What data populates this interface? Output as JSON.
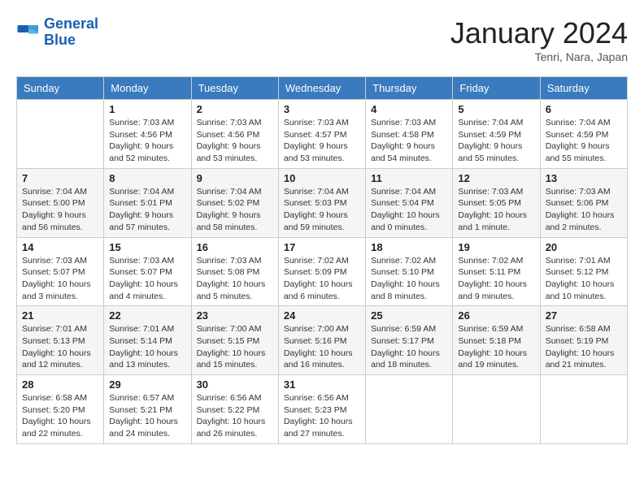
{
  "header": {
    "logo": {
      "line1": "General",
      "line2": "Blue"
    },
    "title": "January 2024",
    "location": "Tenri, Nara, Japan"
  },
  "days_of_week": [
    "Sunday",
    "Monday",
    "Tuesday",
    "Wednesday",
    "Thursday",
    "Friday",
    "Saturday"
  ],
  "weeks": [
    [
      {
        "day": "",
        "info": ""
      },
      {
        "day": "1",
        "info": "Sunrise: 7:03 AM\nSunset: 4:56 PM\nDaylight: 9 hours\nand 52 minutes."
      },
      {
        "day": "2",
        "info": "Sunrise: 7:03 AM\nSunset: 4:56 PM\nDaylight: 9 hours\nand 53 minutes."
      },
      {
        "day": "3",
        "info": "Sunrise: 7:03 AM\nSunset: 4:57 PM\nDaylight: 9 hours\nand 53 minutes."
      },
      {
        "day": "4",
        "info": "Sunrise: 7:03 AM\nSunset: 4:58 PM\nDaylight: 9 hours\nand 54 minutes."
      },
      {
        "day": "5",
        "info": "Sunrise: 7:04 AM\nSunset: 4:59 PM\nDaylight: 9 hours\nand 55 minutes."
      },
      {
        "day": "6",
        "info": "Sunrise: 7:04 AM\nSunset: 4:59 PM\nDaylight: 9 hours\nand 55 minutes."
      }
    ],
    [
      {
        "day": "7",
        "info": "Sunrise: 7:04 AM\nSunset: 5:00 PM\nDaylight: 9 hours\nand 56 minutes."
      },
      {
        "day": "8",
        "info": "Sunrise: 7:04 AM\nSunset: 5:01 PM\nDaylight: 9 hours\nand 57 minutes."
      },
      {
        "day": "9",
        "info": "Sunrise: 7:04 AM\nSunset: 5:02 PM\nDaylight: 9 hours\nand 58 minutes."
      },
      {
        "day": "10",
        "info": "Sunrise: 7:04 AM\nSunset: 5:03 PM\nDaylight: 9 hours\nand 59 minutes."
      },
      {
        "day": "11",
        "info": "Sunrise: 7:04 AM\nSunset: 5:04 PM\nDaylight: 10 hours\nand 0 minutes."
      },
      {
        "day": "12",
        "info": "Sunrise: 7:03 AM\nSunset: 5:05 PM\nDaylight: 10 hours\nand 1 minute."
      },
      {
        "day": "13",
        "info": "Sunrise: 7:03 AM\nSunset: 5:06 PM\nDaylight: 10 hours\nand 2 minutes."
      }
    ],
    [
      {
        "day": "14",
        "info": "Sunrise: 7:03 AM\nSunset: 5:07 PM\nDaylight: 10 hours\nand 3 minutes."
      },
      {
        "day": "15",
        "info": "Sunrise: 7:03 AM\nSunset: 5:07 PM\nDaylight: 10 hours\nand 4 minutes."
      },
      {
        "day": "16",
        "info": "Sunrise: 7:03 AM\nSunset: 5:08 PM\nDaylight: 10 hours\nand 5 minutes."
      },
      {
        "day": "17",
        "info": "Sunrise: 7:02 AM\nSunset: 5:09 PM\nDaylight: 10 hours\nand 6 minutes."
      },
      {
        "day": "18",
        "info": "Sunrise: 7:02 AM\nSunset: 5:10 PM\nDaylight: 10 hours\nand 8 minutes."
      },
      {
        "day": "19",
        "info": "Sunrise: 7:02 AM\nSunset: 5:11 PM\nDaylight: 10 hours\nand 9 minutes."
      },
      {
        "day": "20",
        "info": "Sunrise: 7:01 AM\nSunset: 5:12 PM\nDaylight: 10 hours\nand 10 minutes."
      }
    ],
    [
      {
        "day": "21",
        "info": "Sunrise: 7:01 AM\nSunset: 5:13 PM\nDaylight: 10 hours\nand 12 minutes."
      },
      {
        "day": "22",
        "info": "Sunrise: 7:01 AM\nSunset: 5:14 PM\nDaylight: 10 hours\nand 13 minutes."
      },
      {
        "day": "23",
        "info": "Sunrise: 7:00 AM\nSunset: 5:15 PM\nDaylight: 10 hours\nand 15 minutes."
      },
      {
        "day": "24",
        "info": "Sunrise: 7:00 AM\nSunset: 5:16 PM\nDaylight: 10 hours\nand 16 minutes."
      },
      {
        "day": "25",
        "info": "Sunrise: 6:59 AM\nSunset: 5:17 PM\nDaylight: 10 hours\nand 18 minutes."
      },
      {
        "day": "26",
        "info": "Sunrise: 6:59 AM\nSunset: 5:18 PM\nDaylight: 10 hours\nand 19 minutes."
      },
      {
        "day": "27",
        "info": "Sunrise: 6:58 AM\nSunset: 5:19 PM\nDaylight: 10 hours\nand 21 minutes."
      }
    ],
    [
      {
        "day": "28",
        "info": "Sunrise: 6:58 AM\nSunset: 5:20 PM\nDaylight: 10 hours\nand 22 minutes."
      },
      {
        "day": "29",
        "info": "Sunrise: 6:57 AM\nSunset: 5:21 PM\nDaylight: 10 hours\nand 24 minutes."
      },
      {
        "day": "30",
        "info": "Sunrise: 6:56 AM\nSunset: 5:22 PM\nDaylight: 10 hours\nand 26 minutes."
      },
      {
        "day": "31",
        "info": "Sunrise: 6:56 AM\nSunset: 5:23 PM\nDaylight: 10 hours\nand 27 minutes."
      },
      {
        "day": "",
        "info": ""
      },
      {
        "day": "",
        "info": ""
      },
      {
        "day": "",
        "info": ""
      }
    ]
  ]
}
